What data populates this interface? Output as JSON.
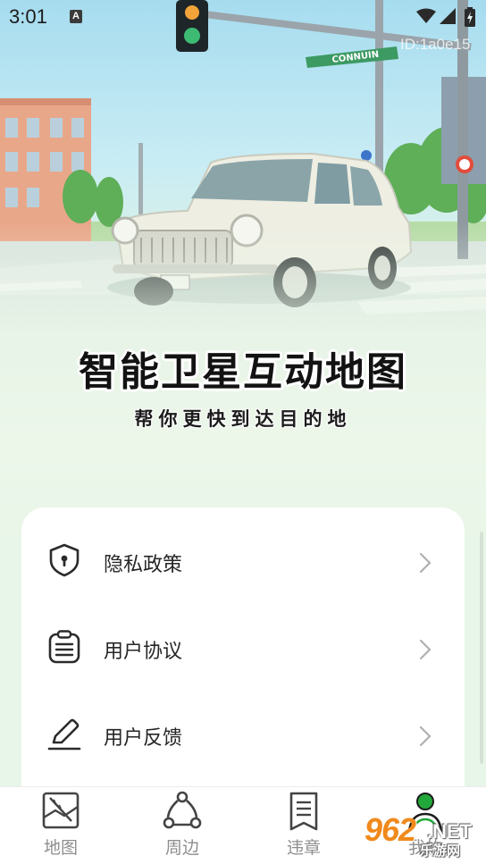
{
  "status_bar": {
    "time": "3:01",
    "notification_icon": "A",
    "icons": [
      "wifi-icon",
      "signal-icon",
      "battery-charging-icon"
    ]
  },
  "watermark_id": "ID:1a0e15",
  "hero": {
    "street_sign": "CONNUIN",
    "headline": "智能卫星互动地图",
    "subline": "帮你更快到达目的地"
  },
  "menu": {
    "items": [
      {
        "label": "隐私政策",
        "icon": "shield-lock-icon"
      },
      {
        "label": "用户协议",
        "icon": "clipboard-list-icon"
      },
      {
        "label": "用户反馈",
        "icon": "pen-edit-icon"
      }
    ]
  },
  "bottom_nav": {
    "items": [
      {
        "label": "地图",
        "icon": "map-icon",
        "active": false
      },
      {
        "label": "周边",
        "icon": "nearby-nodes-icon",
        "active": false
      },
      {
        "label": "违章",
        "icon": "document-icon",
        "active": false
      },
      {
        "label": "我的",
        "icon": "user-icon",
        "active": true
      }
    ]
  },
  "corner_watermark": {
    "number": "962",
    "suffix": ".NET",
    "sub": "乐游网"
  },
  "colors": {
    "accent": "#22a83a",
    "headline": "#121212",
    "nav_label": "#8e8e8e"
  }
}
